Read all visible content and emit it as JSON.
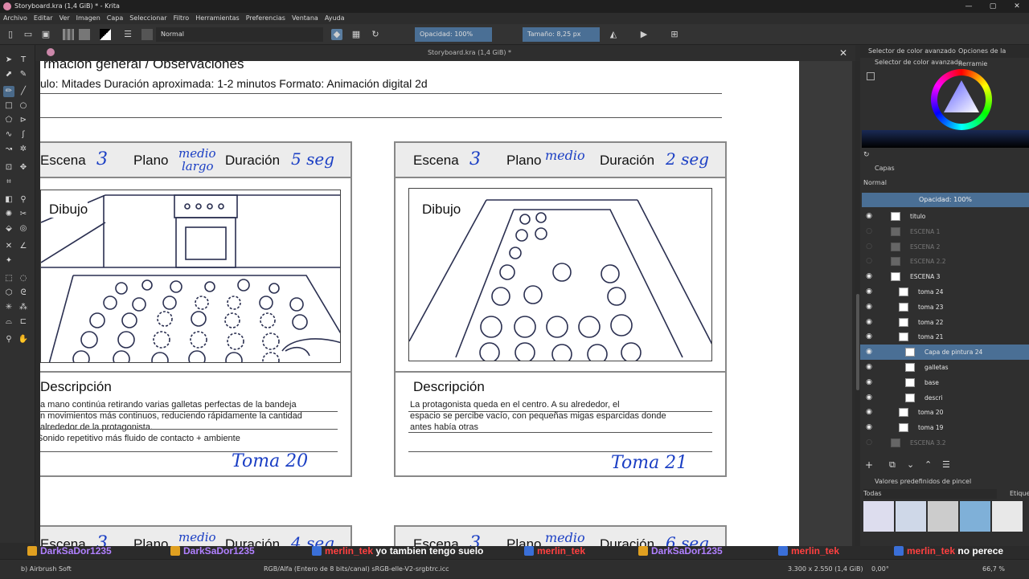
{
  "window": {
    "title": "Storyboard.kra (1,4 GiB) * - Krita",
    "controls": [
      "—",
      "▢",
      "✕"
    ]
  },
  "menu": [
    "Archivo",
    "Editar",
    "Ver",
    "Imagen",
    "Capa",
    "Seleccionar",
    "Filtro",
    "Herramientas",
    "Preferencias",
    "Ventana",
    "Ayuda"
  ],
  "toolbar": {
    "blend_mode": "Normal",
    "opacity": "Opacidad: 100%",
    "size": "Tamaño: 8,25 px"
  },
  "document_tab": {
    "title": "Storyboard.kra (1,4 GiB) *",
    "close": "✕"
  },
  "canvas": {
    "heading": "rmación general / Observaciones",
    "info_line": "ulo: Mitades Duración aproximada: 1-2 minutos Formato: Animación digital 2d",
    "panels": [
      {
        "escena_label": "Escena",
        "escena_value": "3",
        "plano_label": "Plano",
        "plano_value_1": "medio",
        "plano_value_2": "largo",
        "duracion_label": "Duración",
        "duracion_value": "5 seg",
        "dibujo_label": "Dibujo",
        "descripcion_label": "Descripción",
        "descripcion_lines": [
          "a mano continúa retirando varias galletas perfectas de la bandeja",
          "n movimientos más continuos, reduciendo rápidamente la cantidad",
          "alrededor de la protagonista.",
          "Sonido repetitivo más fluido de contacto + ambiente"
        ],
        "toma": "Toma 20"
      },
      {
        "escena_label": "Escena",
        "escena_value": "3",
        "plano_label": "Plano",
        "plano_value_1": "medio",
        "duracion_label": "Duración",
        "duracion_value": "2 seg",
        "dibujo_label": "Dibujo",
        "descripcion_label": "Descripción",
        "descripcion_lines": [
          "La protagonista queda en el centro. A su alrededor, el",
          " espacio se percibe vacío, con pequeñas migas esparcidas donde",
          "antes había otras"
        ],
        "toma": "Toma 21"
      },
      {
        "escena_label": "Escena",
        "escena_value": "3",
        "plano_label": "Plano",
        "plano_value_1": "medio",
        "duracion_label": "Duración",
        "duracion_value": "4 seg"
      },
      {
        "escena_label": "Escena",
        "escena_value": "3",
        "plano_label": "Plano",
        "plano_value_1": "medio",
        "duracion_label": "Duración",
        "duracion_value": "6 seg"
      }
    ]
  },
  "dock": {
    "tabs": [
      "Selector de color avanzado",
      "Opciones de la herramie"
    ],
    "color_selector_label": "Selector de color avanzado",
    "layers_label": "Capas",
    "layers_blend": "Normal",
    "layers_opacity": "Opacidad:  100%",
    "layers": [
      {
        "name": "titulo",
        "visible": true,
        "dim": false,
        "selected": false,
        "indent": 0
      },
      {
        "name": "ESCENA 1",
        "visible": false,
        "dim": true,
        "selected": false,
        "indent": 0
      },
      {
        "name": "ESCENA 2",
        "visible": false,
        "dim": true,
        "selected": false,
        "indent": 0
      },
      {
        "name": "ESCENA 2.2",
        "visible": false,
        "dim": true,
        "selected": false,
        "indent": 0
      },
      {
        "name": "ESCENA 3",
        "visible": true,
        "dim": false,
        "selected": false,
        "indent": 0
      },
      {
        "name": "toma 24",
        "visible": true,
        "dim": false,
        "selected": false,
        "indent": 1
      },
      {
        "name": "toma 23",
        "visible": true,
        "dim": false,
        "selected": false,
        "indent": 1
      },
      {
        "name": "toma 22",
        "visible": true,
        "dim": false,
        "selected": false,
        "indent": 1
      },
      {
        "name": "toma 21",
        "visible": true,
        "dim": false,
        "selected": false,
        "indent": 1
      },
      {
        "name": "Capa de pintura 24",
        "visible": true,
        "dim": false,
        "selected": true,
        "indent": 2
      },
      {
        "name": "galletas",
        "visible": true,
        "dim": false,
        "selected": false,
        "indent": 2
      },
      {
        "name": "base",
        "visible": true,
        "dim": false,
        "selected": false,
        "indent": 2
      },
      {
        "name": "descri",
        "visible": true,
        "dim": false,
        "selected": false,
        "indent": 2
      },
      {
        "name": "toma 20",
        "visible": true,
        "dim": false,
        "selected": false,
        "indent": 1
      },
      {
        "name": "toma 19",
        "visible": true,
        "dim": false,
        "selected": false,
        "indent": 1
      },
      {
        "name": "ESCENA 3.2",
        "visible": false,
        "dim": true,
        "selected": false,
        "indent": 0
      }
    ],
    "brush_presets_label": "Valores predefinidos de pincel",
    "brush_filter": "Todas",
    "brush_tag": "Etique"
  },
  "chat": [
    {
      "user": "DarkSaDor1235",
      "msg": "",
      "red": false
    },
    {
      "user": "DarkSaDor1235",
      "msg": "",
      "red": false
    },
    {
      "user": "merlin_tek",
      "msg": "yo tambien tengo suelo",
      "red": true
    },
    {
      "user": "merlin_tek",
      "msg": "",
      "red": true
    },
    {
      "user": "DarkSaDor1235",
      "msg": "",
      "red": false
    },
    {
      "user": "merlin_tek",
      "msg": "",
      "red": true
    },
    {
      "user": "merlin_tek",
      "msg": "no perece",
      "red": true
    }
  ],
  "status": {
    "brush": "b) Airbrush Soft",
    "color_space": "RGB/Alfa (Entero de 8 bits/canal)  sRGB-elle-V2-srgbtrc.icc",
    "dimensions": "3.300 x 2.550 (1,4 GiB)",
    "rotation": "0,00°",
    "zoom": "66,7 %"
  },
  "colors": {
    "accent": "#4a6f95",
    "ink_blue": "#1b3fc4",
    "chat_purple": "#b080ff",
    "chat_red": "#ff4040"
  }
}
